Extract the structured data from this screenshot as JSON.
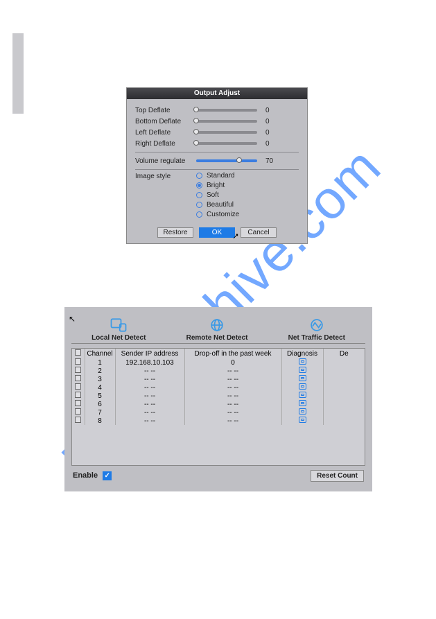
{
  "watermark": "manualshive.com",
  "dialog1": {
    "title": "Output Adjust",
    "sliders": [
      {
        "label": "Top Deflate",
        "value": "0",
        "pos": 0
      },
      {
        "label": "Bottom Deflate",
        "value": "0",
        "pos": 0
      },
      {
        "label": "Left Deflate",
        "value": "0",
        "pos": 0
      },
      {
        "label": "Right Deflate",
        "value": "0",
        "pos": 0
      }
    ],
    "volume": {
      "label": "Volume regulate",
      "value": "70",
      "pos": 70
    },
    "image_style_label": "Image style",
    "radios": [
      {
        "label": "Standard",
        "selected": false
      },
      {
        "label": "Bright",
        "selected": true
      },
      {
        "label": "Soft",
        "selected": false
      },
      {
        "label": "Beautiful",
        "selected": false
      },
      {
        "label": "Customize",
        "selected": false
      }
    ],
    "buttons": {
      "restore": "Restore",
      "ok": "OK",
      "cancel": "Cancel"
    }
  },
  "panel2": {
    "tabs": {
      "local": "Local Net Detect",
      "remote": "Remote Net Detect",
      "traffic": "Net Traffic Detect"
    },
    "table": {
      "headers": {
        "channel": "Channel",
        "sender": "Sender IP address",
        "dropoff": "Drop-off in the past week",
        "diagnosis": "Diagnosis",
        "det": "De"
      },
      "rows": [
        {
          "ch": "1",
          "ip": "192.168.10.103",
          "drop": "0"
        },
        {
          "ch": "2",
          "ip": "-- --",
          "drop": "-- --"
        },
        {
          "ch": "3",
          "ip": "-- --",
          "drop": "-- --"
        },
        {
          "ch": "4",
          "ip": "-- --",
          "drop": "-- --"
        },
        {
          "ch": "5",
          "ip": "-- --",
          "drop": "-- --"
        },
        {
          "ch": "6",
          "ip": "-- --",
          "drop": "-- --"
        },
        {
          "ch": "7",
          "ip": "-- --",
          "drop": "-- --"
        },
        {
          "ch": "8",
          "ip": "-- --",
          "drop": "-- --"
        }
      ]
    },
    "enable_label": "Enable",
    "enable_checked": true,
    "reset_label": "Reset Count"
  }
}
